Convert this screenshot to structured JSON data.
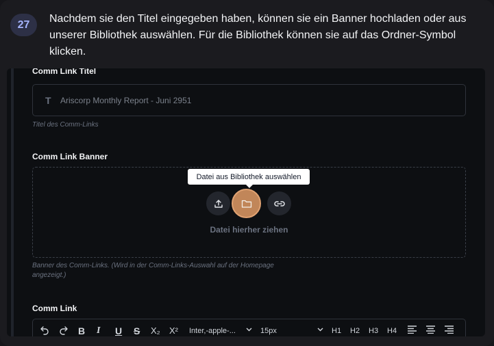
{
  "step": {
    "number": "27",
    "text": "Nachdem sie den Titel eingegeben haben, können sie ein Banner hochladen oder aus unserer Bibliothek auswählen. Für die Bibliothek können sie auf das Ordner-Symbol klicken."
  },
  "form": {
    "title_label": "Comm Link Titel",
    "title_value": "Ariscorp Monthly Report - Juni 2951",
    "title_hint": "Titel des Comm-Links",
    "banner_label": "Comm Link Banner",
    "banner_tooltip": "Datei aus Bibliothek auswählen",
    "banner_drop_text": "Datei hierher ziehen",
    "banner_hint": "Banner des Comm-Links. (Wird in der Comm-Links-Auswahl auf der Homepage angezeigt.)",
    "content_label": "Comm Link"
  },
  "toolbar": {
    "bold": "B",
    "italic": "I",
    "underline": "U",
    "strike": "S",
    "subscript": "X₂",
    "superscript": "X²",
    "font_family": "Inter,-apple-...",
    "font_size": "15px",
    "h1": "H1",
    "h2": "H2",
    "h3": "H3",
    "h4": "H4"
  },
  "colors": {
    "accent_highlight": "#c18659",
    "badge_text": "#a5b4fc",
    "badge_bg": "#2d3046"
  },
  "icons": [
    "upload-icon",
    "folder-icon",
    "link-icon",
    "undo-icon",
    "redo-icon",
    "text-t-icon",
    "chevron-down-icon",
    "align-left-icon",
    "align-center-icon",
    "align-right-icon"
  ]
}
